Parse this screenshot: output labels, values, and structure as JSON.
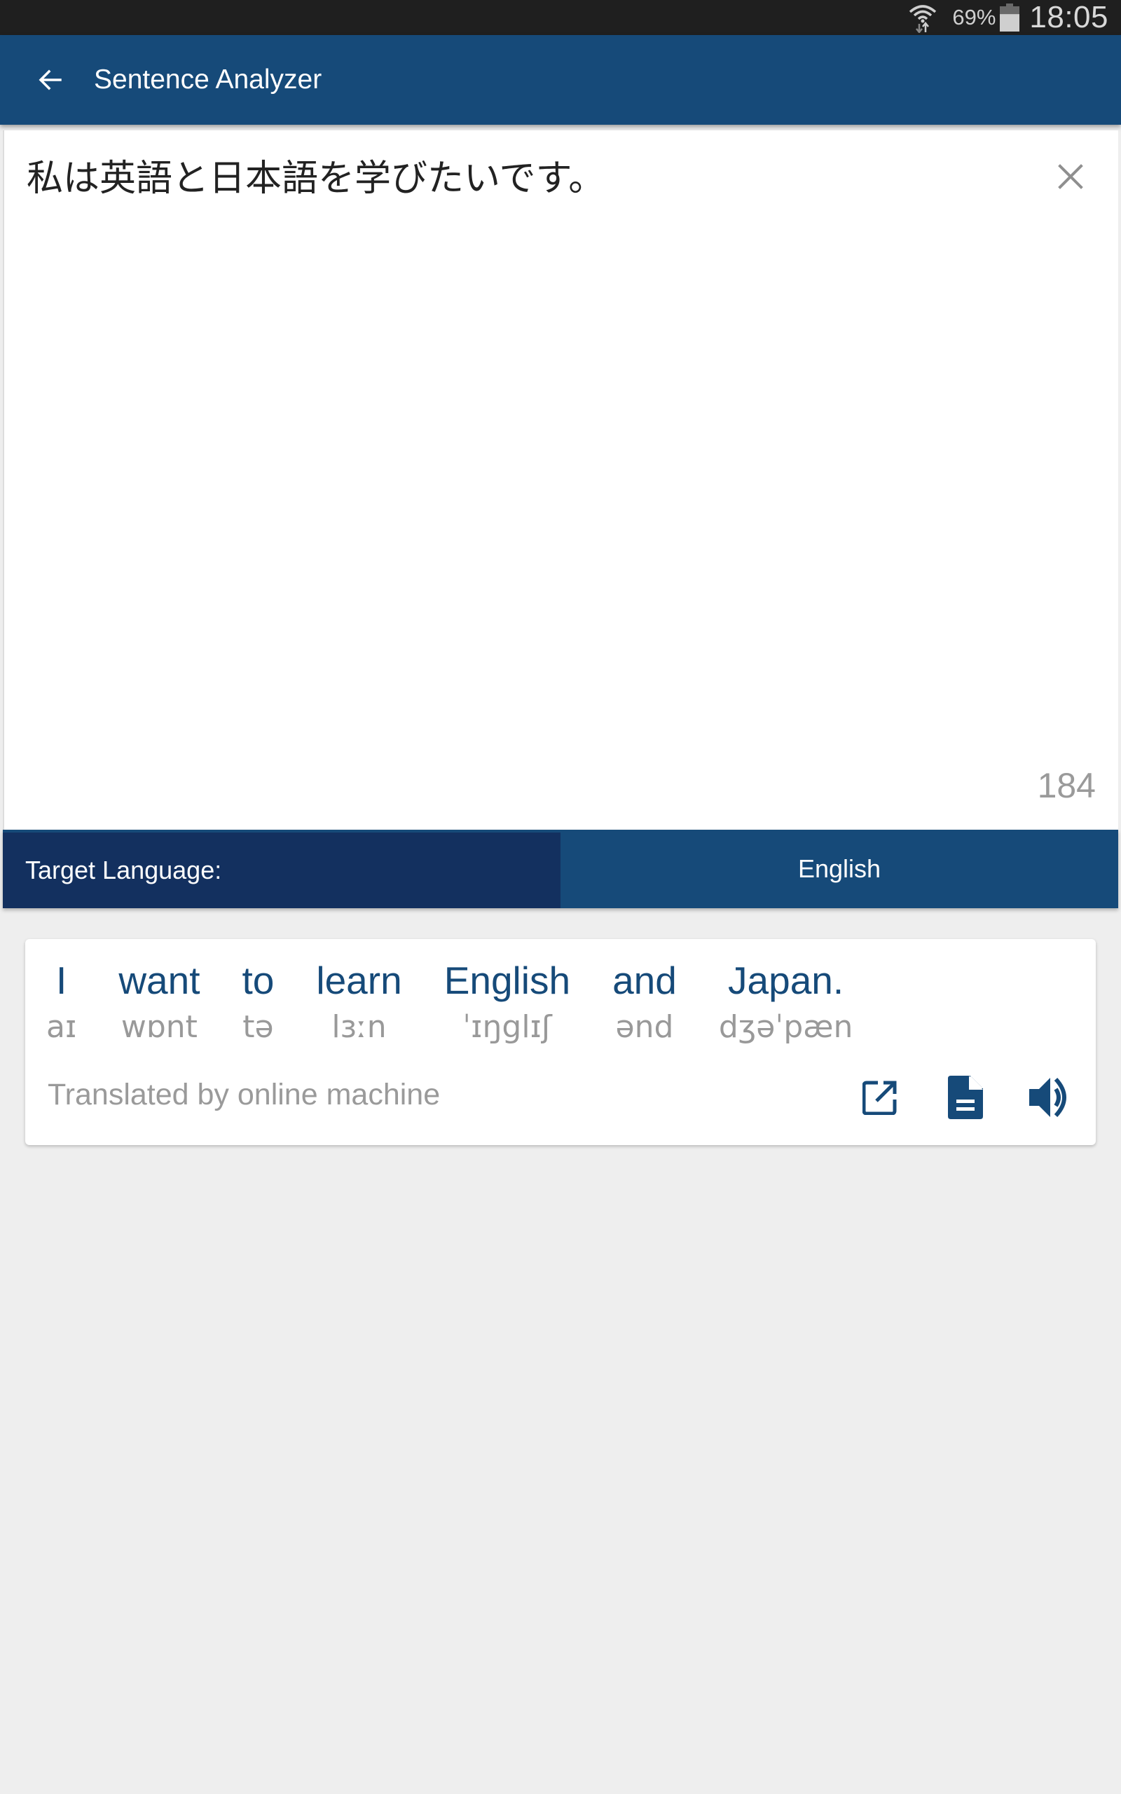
{
  "status_bar": {
    "battery_percent": "69%",
    "battery_level": 0.69,
    "time": "18:05",
    "icons": [
      "wifi-icon",
      "battery-icon"
    ]
  },
  "app_bar": {
    "title": "Sentence Analyzer",
    "back_icon": "arrow-back-icon"
  },
  "input": {
    "value": "私は英語と日本語を学びたいです。",
    "char_count": "184",
    "clear_icon": "close-icon"
  },
  "target_language": {
    "label": "Target Language:",
    "selected": "English"
  },
  "result": {
    "words": [
      {
        "word": "I",
        "phonetic": "aɪ"
      },
      {
        "word": "want",
        "phonetic": "wɒnt"
      },
      {
        "word": "to",
        "phonetic": "tə"
      },
      {
        "word": "learn",
        "phonetic": "lɜːn"
      },
      {
        "word": "English",
        "phonetic": "ˈɪŋglɪʃ"
      },
      {
        "word": "and",
        "phonetic": "ənd"
      },
      {
        "word": "Japan.",
        "phonetic": "dʒəˈpæn"
      }
    ],
    "credit": "Translated by online machine",
    "actions": [
      "open-external-icon",
      "document-icon",
      "speaker-icon"
    ]
  },
  "colors": {
    "primary": "#164a79",
    "primary_dark": "#13305f",
    "status_bar": "#1f1f1f",
    "background": "#eeeeee",
    "muted_text": "#9a9a9a"
  }
}
